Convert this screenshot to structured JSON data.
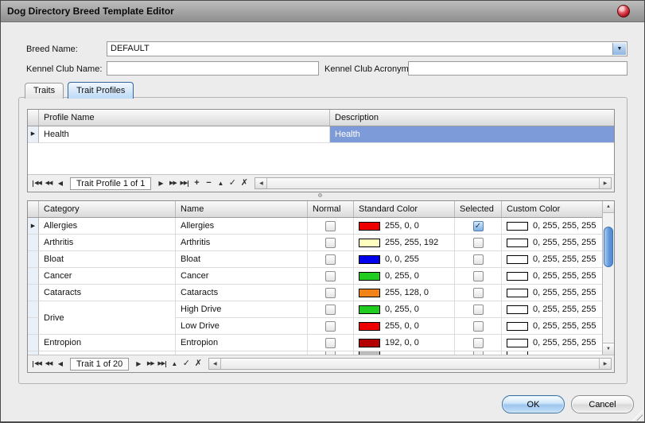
{
  "window": {
    "title": "Dog Directory Breed Template Editor"
  },
  "icons": {
    "close": "close-orb",
    "dropdown_arrow": "▼",
    "row_indicator": "▶",
    "check": "✓",
    "scroll_up": "▲",
    "scroll_down": "▼",
    "scroll_left": "◀",
    "scroll_right": "▶"
  },
  "colors": {
    "selected_cell": "#7E9BD9",
    "active_tab_border": "#3566A0",
    "checkbox_checked": "#7FB0E0",
    "scroll_thumb": "#5E96D8",
    "ok_button": "#9CC5EE",
    "close_button": "#B41622"
  },
  "form": {
    "breed_name": {
      "label": "Breed Name:",
      "value": "DEFAULT"
    },
    "kennel_club_name": {
      "label": "Kennel Club Name:",
      "value": ""
    },
    "kennel_club_acronym": {
      "label": "Kennel Club Acronym:",
      "value": ""
    }
  },
  "tabs": [
    {
      "label": "Traits",
      "active": false
    },
    {
      "label": "Trait Profiles",
      "active": true
    }
  ],
  "profiles_grid": {
    "columns": [
      "Profile Name",
      "Description"
    ],
    "rows": [
      {
        "profile_name": "Health",
        "description": "Health",
        "current": true,
        "description_selected": true
      }
    ],
    "navigator": {
      "text": "Trait Profile 1 of 1",
      "buttons_before": [
        {
          "name": "first-record",
          "glyph": "◀◀",
          "bar": "left"
        },
        {
          "name": "previous-page",
          "glyph": "◀◀"
        },
        {
          "name": "previous-record",
          "glyph": "◀"
        }
      ],
      "buttons_after": [
        {
          "name": "next-record",
          "glyph": "▶"
        },
        {
          "name": "next-page",
          "glyph": "▶▶"
        },
        {
          "name": "last-record",
          "glyph": "▶▶",
          "bar": "right"
        },
        {
          "name": "append-record",
          "glyph": "+",
          "op": true
        },
        {
          "name": "delete-record",
          "glyph": "−",
          "op": true
        },
        {
          "name": "edit-record",
          "glyph": "▲"
        },
        {
          "name": "post-edit",
          "glyph": "✓",
          "op": true
        },
        {
          "name": "cancel-edit",
          "glyph": "✗",
          "op": true
        }
      ]
    }
  },
  "traits_grid": {
    "columns": [
      "Category",
      "Name",
      "Normal",
      "Standard Color",
      "Selected",
      "Custom Color"
    ],
    "rows": [
      {
        "category": "Allergies",
        "name": "Allergies",
        "current": true,
        "normal": false,
        "standard_color": {
          "rgb": "255, 0, 0",
          "hex": "#EE0000"
        },
        "selected": true,
        "custom_color": {
          "rgba": "0, 255, 255, 255",
          "hex": "#FFFFFF"
        }
      },
      {
        "category": "Arthritis",
        "name": "Arthritis",
        "normal": false,
        "standard_color": {
          "rgb": "255, 255, 192",
          "hex": "#FFFFC0"
        },
        "selected": false,
        "custom_color": {
          "rgba": "0, 255, 255, 255",
          "hex": "#FFFFFF"
        }
      },
      {
        "category": "Bloat",
        "name": "Bloat",
        "normal": false,
        "standard_color": {
          "rgb": "0, 0, 255",
          "hex": "#0000EE"
        },
        "selected": false,
        "custom_color": {
          "rgba": "0, 255, 255, 255",
          "hex": "#FFFFFF"
        }
      },
      {
        "category": "Cancer",
        "name": "Cancer",
        "normal": false,
        "standard_color": {
          "rgb": "0, 255, 0",
          "hex": "#1FCC1F"
        },
        "selected": false,
        "custom_color": {
          "rgba": "0, 255, 255, 255",
          "hex": "#FFFFFF"
        }
      },
      {
        "category": "Cataracts",
        "name": "Cataracts",
        "normal": false,
        "standard_color": {
          "rgb": "255, 128, 0",
          "hex": "#F28318"
        },
        "selected": false,
        "custom_color": {
          "rgba": "0, 255, 255, 255",
          "hex": "#FFFFFF"
        }
      },
      {
        "category": "Drive",
        "category_span": 2,
        "name": "High Drive",
        "normal": false,
        "standard_color": {
          "rgb": "0, 255, 0",
          "hex": "#1FCC1F"
        },
        "selected": false,
        "custom_color": {
          "rgba": "0, 255, 255, 255",
          "hex": "#FFFFFF"
        }
      },
      {
        "category": "",
        "category_span": 0,
        "name": "Low Drive",
        "normal": false,
        "standard_color": {
          "rgb": "255, 0, 0",
          "hex": "#EE0000"
        },
        "selected": false,
        "custom_color": {
          "rgba": "0, 255, 255, 255",
          "hex": "#FFFFFF"
        }
      },
      {
        "category": "Entropion",
        "name": "Entropion",
        "normal": false,
        "standard_color": {
          "rgb": "192, 0, 0",
          "hex": "#B30000"
        },
        "selected": false,
        "custom_color": {
          "rgba": "0, 255, 255, 255",
          "hex": "#FFFFFF"
        }
      },
      {
        "category": "",
        "name": "",
        "partial": true,
        "normal": false,
        "standard_color": {
          "rgb": "",
          "hex": "#BBBBBB"
        },
        "selected": false,
        "custom_color": {
          "rgba": "",
          "hex": "#FFFFFF"
        }
      }
    ],
    "navigator": {
      "text": "Trait 1 of 20",
      "buttons_before": [
        {
          "name": "first-record",
          "glyph": "◀◀",
          "bar": "left"
        },
        {
          "name": "previous-page",
          "glyph": "◀◀"
        },
        {
          "name": "previous-record",
          "glyph": "◀"
        }
      ],
      "buttons_after": [
        {
          "name": "next-record",
          "glyph": "▶"
        },
        {
          "name": "next-page",
          "glyph": "▶▶"
        },
        {
          "name": "last-record",
          "glyph": "▶▶",
          "bar": "right"
        },
        {
          "name": "edit-record",
          "glyph": "▲"
        },
        {
          "name": "post-edit",
          "glyph": "✓",
          "op": true
        },
        {
          "name": "cancel-edit",
          "glyph": "✗",
          "op": true
        }
      ]
    }
  },
  "buttons": {
    "ok": "OK",
    "cancel": "Cancel"
  }
}
